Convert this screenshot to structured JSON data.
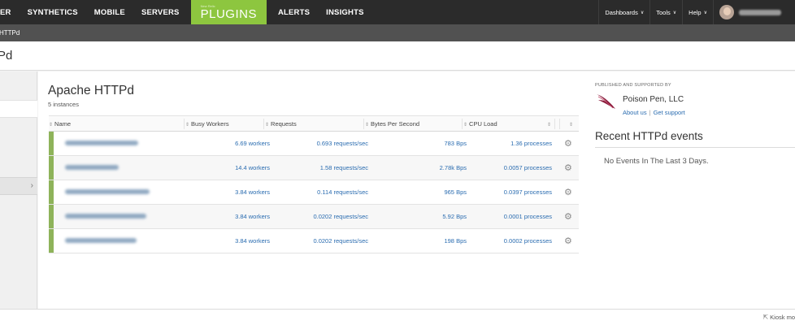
{
  "nav": {
    "items": [
      "ER",
      "SYNTHETICS",
      "MOBILE",
      "SERVERS"
    ],
    "plugins_small": "New Relic",
    "plugins_label": "PLUGINS",
    "items_after": [
      "ALERTS",
      "INSIGHTS"
    ],
    "right_menus": [
      "Dashboards",
      "Tools",
      "Help"
    ]
  },
  "subbar": {
    "text": "HTTPd"
  },
  "titlebar": {
    "text": "Pd"
  },
  "app": {
    "title": "Apache HTTPd",
    "subtitle": "5 instances"
  },
  "table": {
    "columns": [
      "Name",
      "Busy Workers",
      "Requests",
      "Bytes Per Second",
      "CPU Load"
    ],
    "rows": [
      {
        "busy": "6.69 workers",
        "requests": "0.693 requests/sec",
        "bytes": "783 Bps",
        "cpu": "1.36 processes"
      },
      {
        "busy": "14.4 workers",
        "requests": "1.58 requests/sec",
        "bytes": "2.78k Bps",
        "cpu": "0.0057 processes"
      },
      {
        "busy": "3.84 workers",
        "requests": "0.114 requests/sec",
        "bytes": "965 Bps",
        "cpu": "0.0397 processes"
      },
      {
        "busy": "3.84 workers",
        "requests": "0.0202 requests/sec",
        "bytes": "5.92 Bps",
        "cpu": "0.0001 processes"
      },
      {
        "busy": "3.84 workers",
        "requests": "0.0202 requests/sec",
        "bytes": "198 Bps",
        "cpu": "0.0002 processes"
      }
    ]
  },
  "publisher": {
    "label": "PUBLISHED AND SUPPORTED BY",
    "company": "Poison Pen, LLC",
    "about": "About us",
    "support": "Get support"
  },
  "events": {
    "title": "Recent HTTPd events",
    "empty": "No Events In The Last 3 Days."
  },
  "footer": {
    "kiosk": "Kiosk mo"
  },
  "colors": {
    "nav_bg": "#2b2b2b",
    "plugins_green": "#8dc63f",
    "link_blue": "#2a6cb0",
    "row_bar": "#8eb35a"
  },
  "icons": {
    "sort": "sort-arrows-icon",
    "gear": "gear-icon",
    "chevron": "chevron-down-icon",
    "expand": "chevron-right-icon",
    "kiosk": "expand-icon"
  }
}
